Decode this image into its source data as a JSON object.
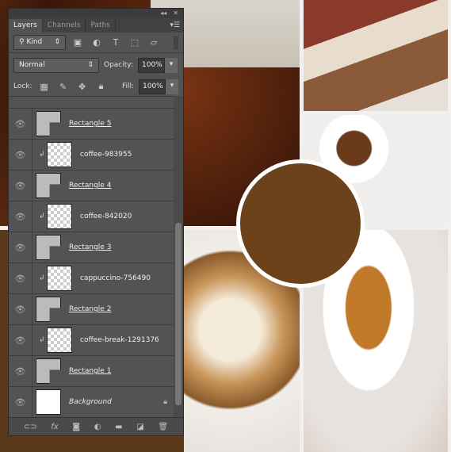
{
  "panel": {
    "tabs": [
      "Layers",
      "Channels",
      "Paths"
    ],
    "filter_kind": "Kind",
    "blend_mode": "Normal",
    "opacity_label": "Opacity:",
    "opacity": "100%",
    "lock_label": "Lock:",
    "fill_label": "Fill:",
    "fill": "100%"
  },
  "layers": [
    {
      "name": "Rectangle 5",
      "type": "shape"
    },
    {
      "name": "coffee-983955",
      "type": "image",
      "clipped": true
    },
    {
      "name": "Rectangle 4",
      "type": "shape"
    },
    {
      "name": "coffee-842020",
      "type": "image",
      "clipped": true
    },
    {
      "name": "Rectangle 3",
      "type": "shape"
    },
    {
      "name": "cappuccino-756490",
      "type": "image",
      "clipped": true
    },
    {
      "name": "Rectangle 2",
      "type": "shape"
    },
    {
      "name": "coffee-break-1291376",
      "type": "image",
      "clipped": true
    },
    {
      "name": "Rectangle 1",
      "type": "shape"
    },
    {
      "name": "Background",
      "type": "background",
      "locked": true
    }
  ],
  "footer": {
    "fx": "fx"
  },
  "colors": {
    "circle": "#6b4219",
    "panel": "#535353"
  }
}
